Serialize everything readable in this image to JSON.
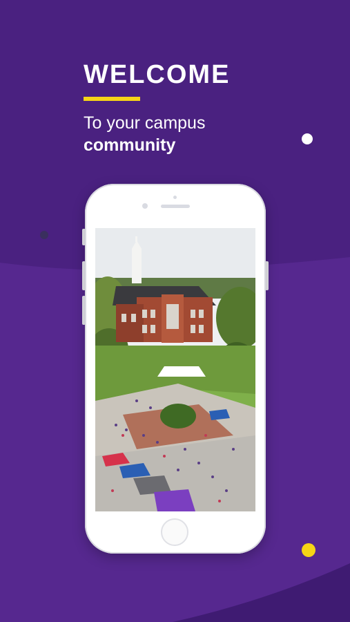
{
  "welcome": {
    "title": "WELCOME",
    "line1": "To your campus",
    "line2": "community"
  },
  "colors": {
    "background": "#4a2180",
    "wave": "#5a2a94",
    "accent": "#f6d516",
    "white": "#ffffff"
  },
  "phone": {
    "screen_image": "campus-aerial-photo",
    "screen_description_icon": "phone-mockup-icon"
  }
}
